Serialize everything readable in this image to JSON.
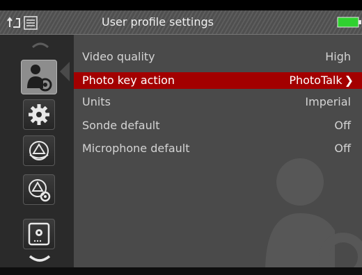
{
  "header": {
    "title": "User profile settings",
    "back_icon": "back-arrow-icon",
    "menu_icon": "list-menu-icon",
    "battery_icon": "battery-full-icon",
    "battery_color": "#2fd12f"
  },
  "sidebar": {
    "items": [
      {
        "name": "user-settings",
        "icon": "user-gear-icon",
        "selected": true
      },
      {
        "name": "system-settings",
        "icon": "gear-icon",
        "selected": false
      },
      {
        "name": "steering",
        "icon": "steering-wheel-icon",
        "selected": false
      },
      {
        "name": "steering-settings",
        "icon": "steering-wheel-gear-icon",
        "selected": false
      },
      {
        "name": "display-settings",
        "icon": "monitor-gear-icon",
        "selected": false
      }
    ]
  },
  "settings": {
    "rows": [
      {
        "label": "Video quality",
        "value": "High"
      },
      {
        "label": "Photo key action",
        "value": "PhotoTalk",
        "highlighted": true
      },
      {
        "label": "Units",
        "value": "Imperial"
      },
      {
        "label": "Sonde default",
        "value": "Off"
      },
      {
        "label": "Microphone default",
        "value": "Off"
      }
    ],
    "highlight_color": "#a30000"
  }
}
